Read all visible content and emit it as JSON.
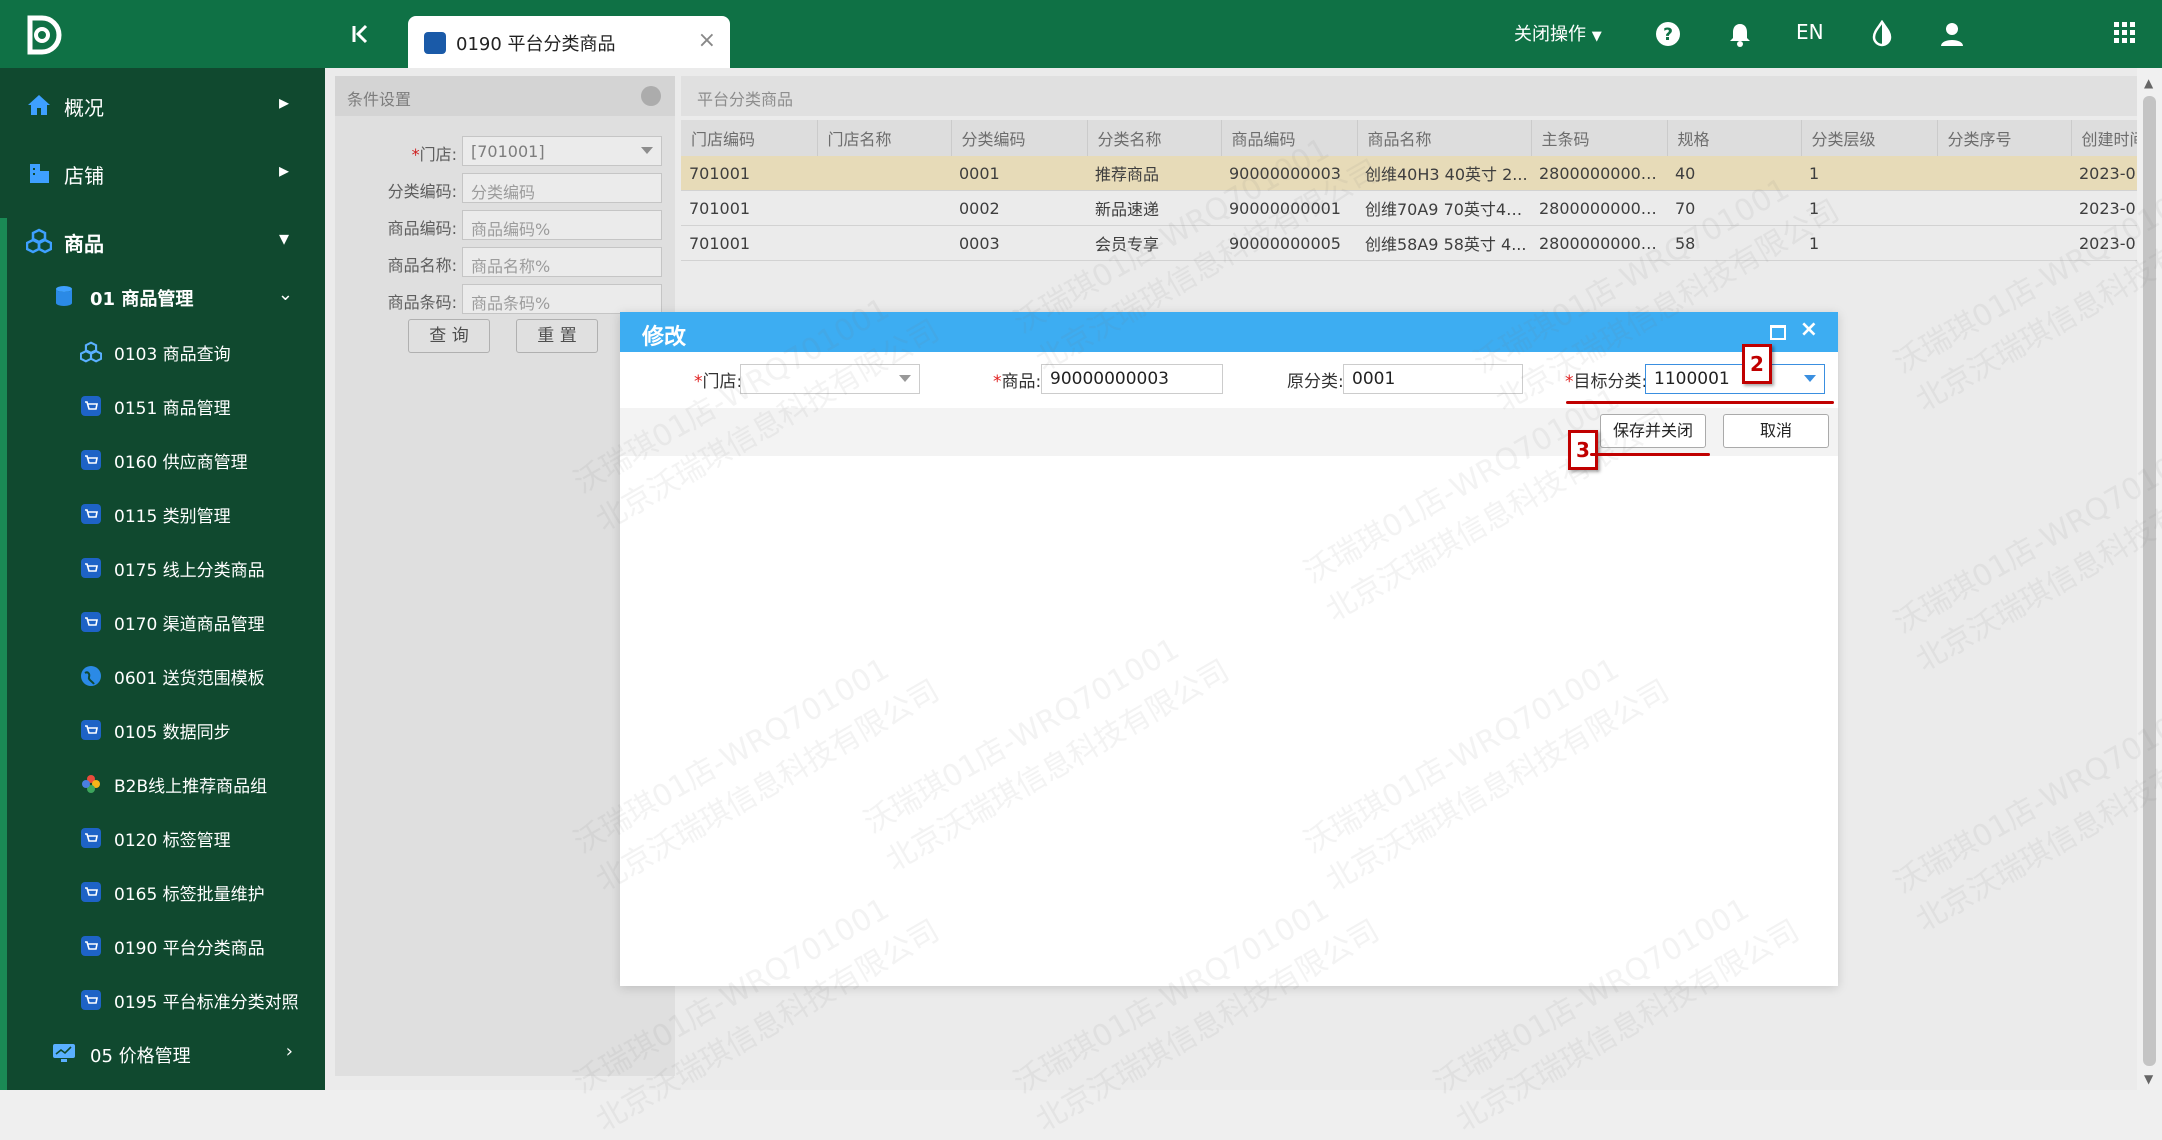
{
  "topbar": {
    "tab_label": "0190 平台分类商品",
    "tab_close": "×",
    "close_ops": "关闭操作",
    "lang": "EN"
  },
  "sidebar": {
    "items": [
      {
        "label": "概况",
        "icon": "home-icon"
      },
      {
        "label": "店铺",
        "icon": "store-icon"
      },
      {
        "label": "商品",
        "icon": "cubes-icon"
      }
    ],
    "group": {
      "label": "01 商品管理",
      "icon": "database-icon"
    },
    "subitems": [
      {
        "label": "0103 商品查询",
        "icon": "cubes-icon"
      },
      {
        "label": "0151 商品管理",
        "icon": "cart-icon"
      },
      {
        "label": "0160 供应商管理",
        "icon": "cart-icon"
      },
      {
        "label": "0115 类别管理",
        "icon": "cart-icon"
      },
      {
        "label": "0175 线上分类商品",
        "icon": "cart-icon"
      },
      {
        "label": "0170 渠道商品管理",
        "icon": "cart-icon"
      },
      {
        "label": "0601 送货范围模板",
        "icon": "globe-icon"
      },
      {
        "label": "0105 数据同步",
        "icon": "cart-icon"
      },
      {
        "label": "B2B线上推荐商品组",
        "icon": "colorful-icon"
      },
      {
        "label": "0120 标签管理",
        "icon": "cart-icon"
      },
      {
        "label": "0165 标签批量维护",
        "icon": "cart-icon"
      },
      {
        "label": "0190 平台分类商品",
        "icon": "cart-icon"
      },
      {
        "label": "0195 平台标准分类对照",
        "icon": "cart-icon"
      }
    ],
    "group2": {
      "label": "05 价格管理",
      "icon": "monitor-icon"
    }
  },
  "conditions": {
    "title": "条件设置",
    "fields": [
      {
        "label": "门店:",
        "value": "[701001]",
        "required": "*"
      },
      {
        "label": "分类编码:",
        "placeholder": "分类编码"
      },
      {
        "label": "商品编码:",
        "placeholder": "商品编码%"
      },
      {
        "label": "商品名称:",
        "placeholder": "商品名称%"
      },
      {
        "label": "商品条码:",
        "placeholder": "商品条码%"
      }
    ],
    "query_btn": "查 询",
    "reset_btn": "重 置"
  },
  "grid": {
    "title": "平台分类商品",
    "columns": [
      "门店编码",
      "门店名称",
      "分类编码",
      "分类名称",
      "商品编码",
      "商品名称",
      "主条码",
      "规格",
      "分类层级",
      "分类序号",
      "创建时间"
    ],
    "rows": [
      [
        "701001",
        "",
        "0001",
        "推荐商品",
        "90000000003",
        "创维40H3 40英寸 2...",
        "28000000000...",
        "40",
        "1",
        "",
        "2023-0"
      ],
      [
        "701001",
        "",
        "0002",
        "新品速递",
        "90000000001",
        "创维70A9 70英寸4K...",
        "28000000000...",
        "70",
        "1",
        "",
        "2023-0"
      ],
      [
        "701001",
        "",
        "0003",
        "会员专享",
        "90000000005",
        "创维58A9 58英寸 4...",
        "28000000000...",
        "58",
        "1",
        "",
        "2023-0"
      ]
    ]
  },
  "dialog": {
    "title": "修改",
    "store_label": "门店:",
    "store_value": "",
    "product_label": "商品:",
    "product_value": "90000000003",
    "orig_label": "原分类:",
    "orig_value": "0001",
    "target_label": "目标分类:",
    "target_value": "1100001",
    "required": "*",
    "save_close": "保存并关闭",
    "cancel": "取消"
  },
  "annotations": {
    "step2": "2",
    "step3": "3"
  },
  "watermark": {
    "line1": "沃瑞琪01店-WRQ701001",
    "line2": "北京沃瑞琪信息科技有限公司"
  },
  "colors": {
    "topbar": "#0f7145",
    "sidebar": "#10492f",
    "dialog_title": "#3dadf2",
    "selected_row": "#fbeec8",
    "annotation": "#c00000"
  }
}
